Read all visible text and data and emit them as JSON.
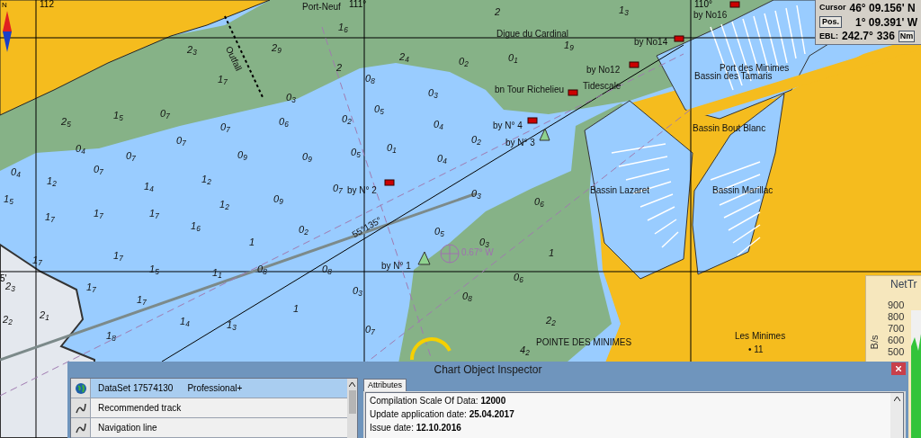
{
  "status_panel": {
    "cursor_label": "Cursor",
    "latitude": "46° 09.156' N",
    "pos_button": "Pos.",
    "longitude": "1° 09.391' W",
    "ebl_label": "EBL:",
    "bearing": "242.7°",
    "distance": "336",
    "unit_button": "Nm"
  },
  "chart": {
    "north_label": "N",
    "grid_labels": [
      "112",
      "111°",
      "110°",
      "5'"
    ],
    "places": [
      "Port-Neuf",
      "Digue du Cardinal",
      "Port des Minimes",
      "Bassin des Tamaris",
      "Bassin Bout Blanc",
      "Bassin Lazaret",
      "Bassin Marillac",
      "POINTE DES MINIMES",
      "Les Minimes",
      "• 11",
      "Outfall",
      "Tidescale",
      "0.67° W",
      "55°135°"
    ],
    "marks": [
      "by No16",
      "by No14",
      "by No12",
      "bn Tour Richelieu",
      "by N° 4",
      "by N° 3",
      "by N° 2",
      "by N° 1"
    ],
    "soundings": [
      "2",
      "1$_{3}$",
      "1$_{6}$",
      "2$_{3}$",
      "2$_{9}$",
      "1$_{9}$",
      "2$_{4}$",
      "0$_{2}$",
      "0$_{1}$",
      "2",
      "1$_{7}$",
      "0$_{8}$",
      "0$_{3}$",
      "0$_{3}$",
      "0$_{5}$",
      "2$_{5}$",
      "1$_{5}$",
      "0$_{7}$",
      "0$_{7}$",
      "0$_{6}$",
      "0$_{2}$",
      "0$_{4}$",
      "0$_{7}$",
      "0$_{2}$",
      "0$_{4}$",
      "0$_{7}$",
      "0$_{9}$",
      "0$_{9}$",
      "0$_{5}$",
      "0$_{1}$",
      "0$_{4}$",
      "0$_{4}$",
      "0$_{7}$",
      "1$_{2}$",
      "1$_{4}$",
      "1$_{2}$",
      "0$_{7}$",
      "1$_{5}$",
      "1$_{2}$",
      "0$_{9}$",
      "0$_{3}$",
      "0$_{6}$",
      "1$_{7}$",
      "1$_{7}$",
      "1$_{7}$",
      "1$_{6}$",
      "0$_{2}$",
      "0$_{5}$",
      "1",
      "0$_{3}$",
      "1$_{7}$",
      "1$_{7}$",
      "1",
      "1$_{5}$",
      "1$_{1}$",
      "0$_{8}$",
      "0$_{8}$",
      "0$_{6}$",
      "2$_{3}$",
      "1$_{7}$",
      "0$_{3}$",
      "1$_{7}$",
      "0$_{8}$",
      "1",
      "2$_{2}$",
      "2$_{1}$",
      "1$_{4}$",
      "1$_{3}$",
      "2$_{2}$",
      "1$_{8}$",
      "0$_{7}$",
      "4$_{2}$"
    ]
  },
  "net_panel": {
    "title": "NetTr",
    "axis_labels": [
      "900",
      "800",
      "700",
      "600",
      "500"
    ],
    "unit": "B/s"
  },
  "inspector": {
    "title": "Chart Object Inspector",
    "objects": [
      {
        "kind": "dataset",
        "label": "DataSet 17574130",
        "edition": "Professional+",
        "selected": true
      },
      {
        "kind": "track",
        "label": "Recommended track",
        "selected": false
      },
      {
        "kind": "track",
        "label": "Navigation line",
        "selected": false
      }
    ],
    "tabs": [
      {
        "label": "Attributes",
        "selected": true
      }
    ],
    "attributes": [
      {
        "name": "Compilation Scale Of Data:",
        "value": "12000"
      },
      {
        "name": "Update application date:",
        "value": "25.04.2017"
      },
      {
        "name": "Issue date:",
        "value": "12.10.2016"
      }
    ]
  }
}
